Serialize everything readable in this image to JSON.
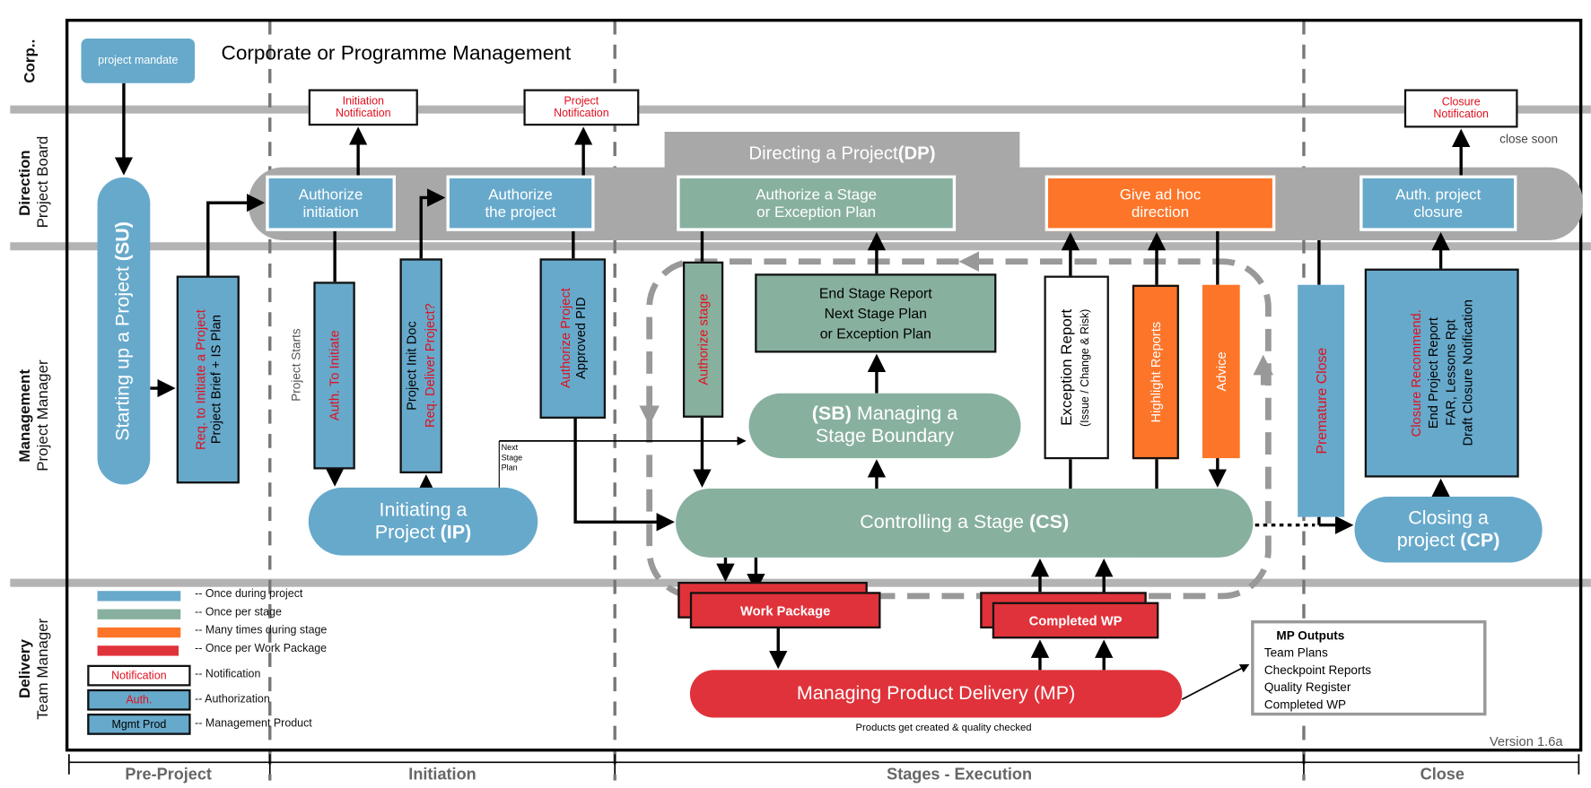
{
  "corp": {
    "mandate": "project mandate",
    "title": "Corporate or Programme Management"
  },
  "lanes": [
    {
      "bold": "Corp..",
      "sub": ""
    },
    {
      "bold": "Direction",
      "sub": "Project Board"
    },
    {
      "bold": "Management",
      "sub": "Project Manager"
    },
    {
      "bold": "Delivery",
      "sub": "Team Manager"
    }
  ],
  "phases": [
    "Pre-Project",
    "Initiation",
    "Stages - Execution",
    "Close"
  ],
  "notifications": {
    "initiation": [
      "Initiation",
      "Notification"
    ],
    "project": [
      "Project",
      "Notification"
    ],
    "closure": [
      "Closure",
      "Notification"
    ],
    "close_soon": "close soon"
  },
  "dp": {
    "label": "Directing a Project ",
    "abbr": "(DP)",
    "auth_initiation": [
      "Authorize",
      "initiation"
    ],
    "auth_project": [
      "Authorize",
      "the project"
    ],
    "auth_stage": [
      "Authorize a Stage",
      "or Exception Plan"
    ],
    "ad_hoc": [
      "Give ad hoc",
      "direction"
    ],
    "auth_closure": [
      "Auth. project",
      "closure"
    ]
  },
  "su": {
    "label": "Starting up a Project ",
    "abbr": "(SU)"
  },
  "products": {
    "req_initiate": {
      "red": "Req. to Initiate a Project",
      "black": "Project Brief + IS Plan"
    },
    "project_starts": "Project  Starts",
    "auth_to_initiate": "Auth. To Initiate",
    "pid": {
      "black": "Project  Init  Doc",
      "red": "Req. Deliver Project?"
    },
    "auth_project": {
      "red": "Authorize Project",
      "black": "Approved PID"
    },
    "next_stage_plan": [
      "Next",
      "Stage",
      "Plan"
    ],
    "auth_stage": "Authorize  stage",
    "end_stage": [
      "End Stage Report",
      "Next Stage Plan",
      "or Exception Plan"
    ],
    "exception": {
      "main": "Exception Report",
      "sub": "(Issue / Change & Risk)"
    },
    "highlight": "Highlight Reports",
    "advice": "Advice",
    "premature": "Premature Close",
    "closure_rec": {
      "red": "Closure Recommend.",
      "lines": [
        "End Project Report",
        "FAR, Lessons Rpt",
        "Draft Closure Notification"
      ]
    },
    "work_package": "Work Package",
    "completed_wp": "Completed WP"
  },
  "ip": {
    "label": [
      "Initiating a",
      "Project "
    ],
    "abbr": "(IP)"
  },
  "sb": {
    "abbr": "(SB)",
    "label": [
      " Managing a",
      "Stage Boundary"
    ]
  },
  "cs": {
    "label": "Controlling a Stage ",
    "abbr": "(CS)"
  },
  "cp": {
    "label": [
      "Closing a",
      "project "
    ],
    "abbr": "(CP)"
  },
  "mp": {
    "label": "Managing Product Delivery (MP)",
    "note": "Products get created & quality checked"
  },
  "mp_outputs": {
    "title": "MP Outputs",
    "items": [
      "Team Plans",
      "Checkpoint Reports",
      "Quality Register",
      "Completed WP"
    ]
  },
  "legend": {
    "bars": [
      {
        "color": "#67a9cb",
        "label": "-- Once during project"
      },
      {
        "color": "#88b09f",
        "label": "-- Once per stage"
      },
      {
        "color": "#fd7529",
        "label": "-- Many times during stage"
      },
      {
        "color": "#e0323a",
        "label": "-- Once per Work Package"
      }
    ],
    "boxes": [
      {
        "box": "Notification",
        "label": "-- Notification"
      },
      {
        "box": "Auth.",
        "label": "-- Authorization"
      },
      {
        "box": "Mgmt Prod",
        "label": "-- Management Product"
      }
    ]
  },
  "version": "Version 1.6a"
}
